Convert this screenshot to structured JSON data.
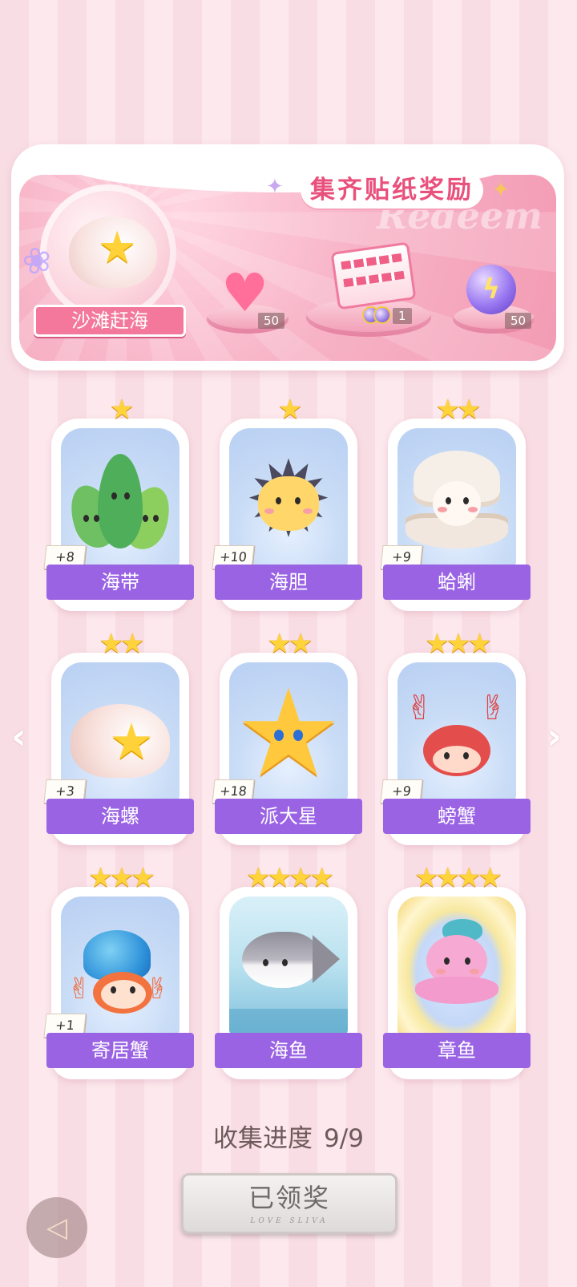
{
  "banner": {
    "title": "集齐贴纸奖励",
    "watermark": "Redeem",
    "album_name": "沙滩赶海",
    "rewards": [
      {
        "icon": "pink-heart-gem-icon",
        "count": "50"
      },
      {
        "icon": "gift-box-icon",
        "count": "1"
      },
      {
        "icon": "purple-energy-orb-icon",
        "count": "50"
      }
    ]
  },
  "cards": [
    {
      "name": "海带",
      "stars": "★",
      "bonus": "+8",
      "icon": "seaweed-icon"
    },
    {
      "name": "海胆",
      "stars": "★",
      "bonus": "+10",
      "icon": "sea-urchin-icon"
    },
    {
      "name": "蛤蜊",
      "stars": "★★",
      "bonus": "+9",
      "icon": "clam-icon"
    },
    {
      "name": "海螺",
      "stars": "★★",
      "bonus": "+3",
      "icon": "conch-icon"
    },
    {
      "name": "派大星",
      "stars": "★★",
      "bonus": "+18",
      "icon": "starfish-icon"
    },
    {
      "name": "螃蟹",
      "stars": "★★★",
      "bonus": "+9",
      "icon": "crab-icon"
    },
    {
      "name": "寄居蟹",
      "stars": "★★★",
      "bonus": "+1",
      "icon": "hermit-crab-icon"
    },
    {
      "name": "海鱼",
      "stars": "★★★★",
      "bonus": "",
      "icon": "fish-icon"
    },
    {
      "name": "章鱼",
      "stars": "★★★★",
      "bonus": "",
      "icon": "octopus-icon"
    }
  ],
  "progress": {
    "label": "收集进度",
    "value": "9/9"
  },
  "claim_button": {
    "label": "已领奖",
    "sub": "LOVE SLIVA"
  },
  "nav": {
    "prev": "‹",
    "next": "›",
    "back": "◁"
  },
  "colors": {
    "accent": "#9a63e4",
    "banner_pink": "#f39bb4",
    "star_gold": "#ffd43b"
  }
}
